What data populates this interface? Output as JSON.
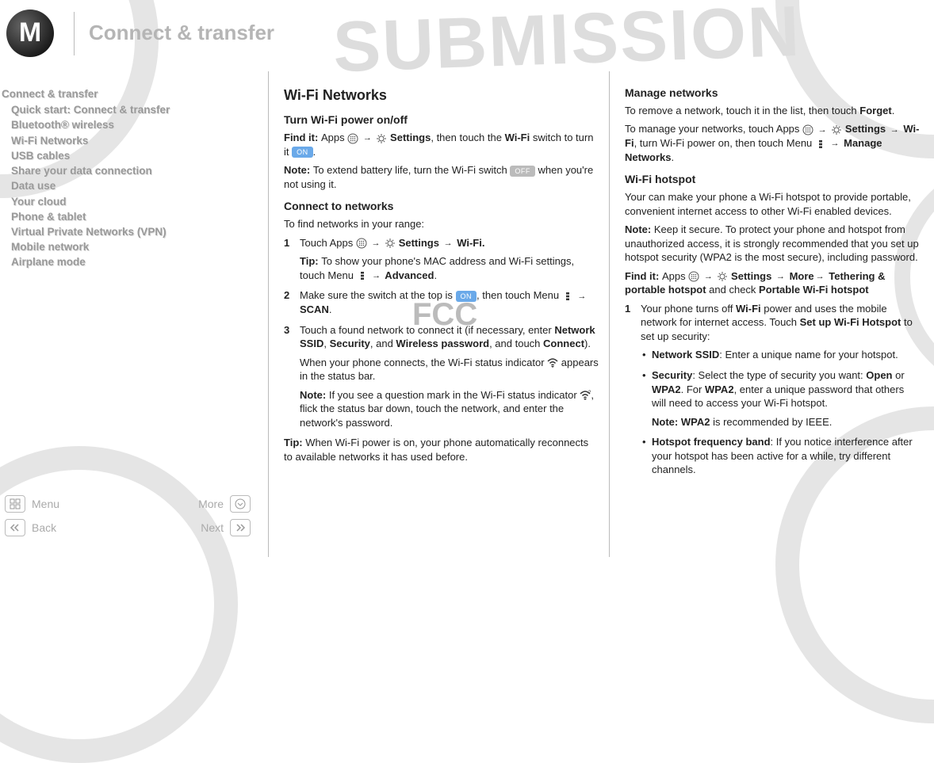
{
  "header": {
    "title": "Connect & transfer"
  },
  "nav": {
    "heading": "Connect & transfer",
    "items": [
      "Quick start: Connect & transfer",
      "Bluetooth® wireless",
      "Wi-Fi Networks",
      "USB cables",
      "Share your data connection",
      "Data use",
      "Your cloud",
      "Phone & tablet",
      "Virtual Private Networks (VPN)",
      "Mobile network",
      "Airplane mode"
    ]
  },
  "botnav": {
    "menu": "Menu",
    "more": "More",
    "back": "Back",
    "next": "Next"
  },
  "watermark": {
    "big": "SUBMISSION",
    "small": "FCC"
  },
  "icons": {
    "arrow": "→"
  },
  "pills": {
    "on": "ON",
    "off": "OFF"
  },
  "colA": {
    "h2": "Wi-Fi Networks",
    "sec1_h3": "Turn Wi-Fi power on/off",
    "sec1_findit_pre": "Find it: ",
    "sec1_findit_a": "Apps ",
    "sec1_findit_b": " Settings",
    "sec1_findit_c": ", then touch the ",
    "sec1_findit_d": "Wi-Fi",
    "sec1_findit_e": " switch to turn it ",
    "sec1_findit_f": ".",
    "sec1_note_pre": "Note: ",
    "sec1_note_a": "To extend battery life, turn the Wi-Fi switch ",
    "sec1_note_b": " when you're not using it.",
    "sec2_h3": "Connect to networks",
    "sec2_intro": "To find networks in your range:",
    "step1_a": "Touch Apps ",
    "step1_b": " Settings ",
    "step1_c": " Wi-Fi.",
    "step1_tip_pre": "Tip: ",
    "step1_tip_a": "To show your phone's MAC address and Wi-Fi settings, touch Menu ",
    "step1_tip_b": " Advanced",
    "step1_tip_c": ".",
    "step2_a": "Make sure the switch at the top is ",
    "step2_b": ", then touch Menu ",
    "step2_c": " SCAN",
    "step2_d": ".",
    "step3_a": "Touch a found network to connect it (if necessary, enter ",
    "step3_b": "Network SSID",
    "step3_c": ", ",
    "step3_d": "Security",
    "step3_e": ", and ",
    "step3_f": "Wireless password",
    "step3_g": ", and touch ",
    "step3_h": "Connect",
    "step3_i": ").",
    "step3_p2_a": "When your phone connects, the Wi-Fi status indicator ",
    "step3_p2_b": " appears in the status bar.",
    "step3_note_pre": "Note: ",
    "step3_note_a": "If you see a question mark in the Wi-Fi status indicator ",
    "step3_note_b": ", flick the status bar down, touch the network, and enter the network's password.",
    "tail_tip_pre": "Tip: ",
    "tail_tip": "When Wi-Fi power is on, your phone automatically reconnects to available networks it has used before."
  },
  "colB": {
    "sec1_h3": "Manage networks",
    "sec1_p1_a": "To remove a network, touch it in the list, then touch ",
    "sec1_p1_b": "Forget",
    "sec1_p1_c": ".",
    "sec1_p2_a": "To manage your networks, touch Apps ",
    "sec1_p2_b": " Settings ",
    "sec1_p2_c": " Wi-Fi",
    "sec1_p2_d": ", turn Wi-Fi power on, then touch Menu ",
    "sec1_p2_e": " Manage Networks",
    "sec1_p2_f": ".",
    "sec2_h3": "Wi-Fi hotspot",
    "sec2_p1": "Your can make your phone a Wi-Fi hotspot to provide portable, convenient internet access to other Wi-Fi enabled devices.",
    "sec2_note_pre": "Note: ",
    "sec2_note": "Keep it secure. To protect your phone and hotspot from unauthorized access, it is strongly recommended that you set up hotspot security (WPA2 is the most secure), including password.",
    "sec2_findit_pre": "Find it: ",
    "sec2_findit_a": "Apps ",
    "sec2_findit_b": " Settings ",
    "sec2_findit_c": " More",
    "sec2_findit_d": " Tethering & portable hotspot",
    "sec2_findit_e": " and check ",
    "sec2_findit_f": "Portable Wi-Fi hotspot",
    "step1_a": "Your phone turns off ",
    "step1_b": "Wi-Fi",
    "step1_c": " power and uses the mobile network for internet access. Touch ",
    "step1_d": "Set up Wi-Fi Hotspot",
    "step1_e": " to set up security:",
    "b1_a": "Network SSID",
    "b1_b": ": Enter a unique name for your hotspot.",
    "b2_a": "Security",
    "b2_b": ": Select the type of security you want: ",
    "b2_c": "Open",
    "b2_d": " or ",
    "b2_e": "WPA2",
    "b2_f": ". For ",
    "b2_g": "WPA2",
    "b2_h": ", enter a unique password that others will need to access your Wi-Fi hotspot.",
    "b2_note_pre": "Note: ",
    "b2_note_a": "WPA2",
    "b2_note_b": " is recommended by IEEE.",
    "b3_a": "Hotspot frequency band",
    "b3_b": ": If you notice interference after your hotspot has been active for a while, try different channels."
  }
}
